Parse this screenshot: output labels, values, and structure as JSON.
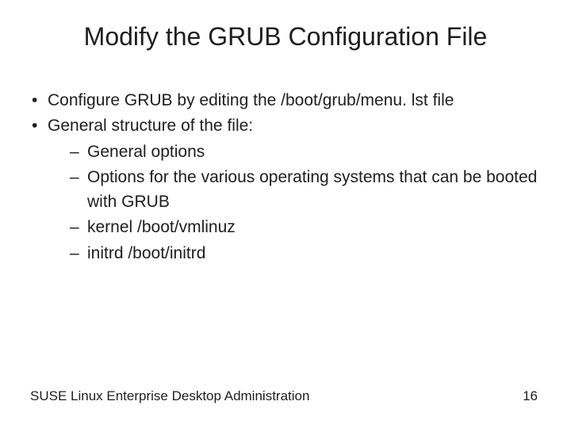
{
  "title": "Modify the GRUB Configuration File",
  "bullets": {
    "b0": "Configure GRUB by editing the /boot/grub/menu. lst file",
    "b1": "General structure of the file:",
    "sub": {
      "s0": "General options",
      "s1": "Options for the various operating systems that can be booted with GRUB",
      "s2": "kernel /boot/vmlinuz",
      "s3": "initrd /boot/initrd"
    }
  },
  "footer": {
    "left": "SUSE Linux Enterprise Desktop Administration",
    "page": "16"
  }
}
